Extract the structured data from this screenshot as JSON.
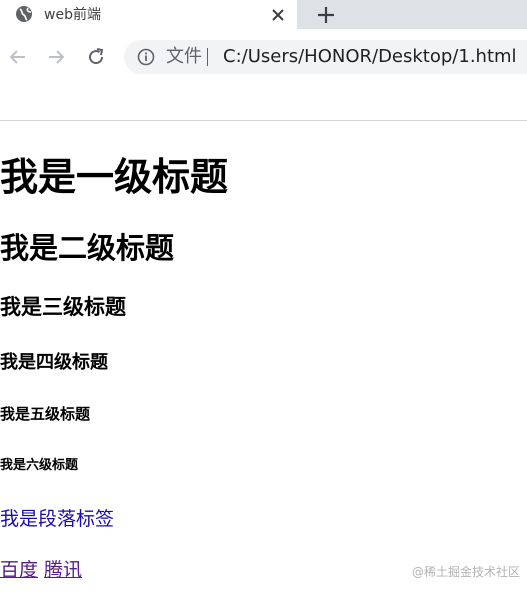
{
  "tab": {
    "title": "web前端"
  },
  "omnibox": {
    "chip_label": "文件",
    "url": "C:/Users/HONOR/Desktop/1.html"
  },
  "page": {
    "h1": "我是一级标题",
    "h2": "我是二级标题",
    "h3": "我是三级标题",
    "h4": "我是四级标题",
    "h5": "我是五级标题",
    "h6": "我是六级标题",
    "paragraph": "我是段落标签",
    "links": [
      "百度",
      "腾讯"
    ],
    "watermark": "@稀土掘金技术社区"
  },
  "colors": {
    "tabstrip": "#dee1e6",
    "omnibox": "#f1f3f4",
    "link_visited": "#551a8b",
    "paragraph": "#1a0dab"
  }
}
